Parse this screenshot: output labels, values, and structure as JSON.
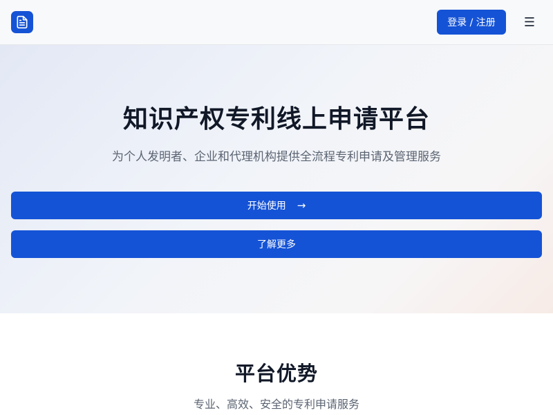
{
  "header": {
    "logo_icon": "document-icon",
    "login_label": "登录 / 注册",
    "menu_glyph": "☰",
    "menu_icon": "hamburger-menu-icon"
  },
  "hero": {
    "title": "知识产权专利线上申请平台",
    "subtitle": "为个人发明者、企业和代理机构提供全流程专利申请及管理服务",
    "start_label": "开始使用",
    "start_arrow": "→",
    "learn_more_label": "了解更多"
  },
  "features": {
    "title": "平台优势",
    "subtitle": "专业、高效、安全的专利申请服务"
  },
  "colors": {
    "accent": "#1553d6",
    "text_primary": "#111827",
    "text_secondary": "#5b6472"
  }
}
